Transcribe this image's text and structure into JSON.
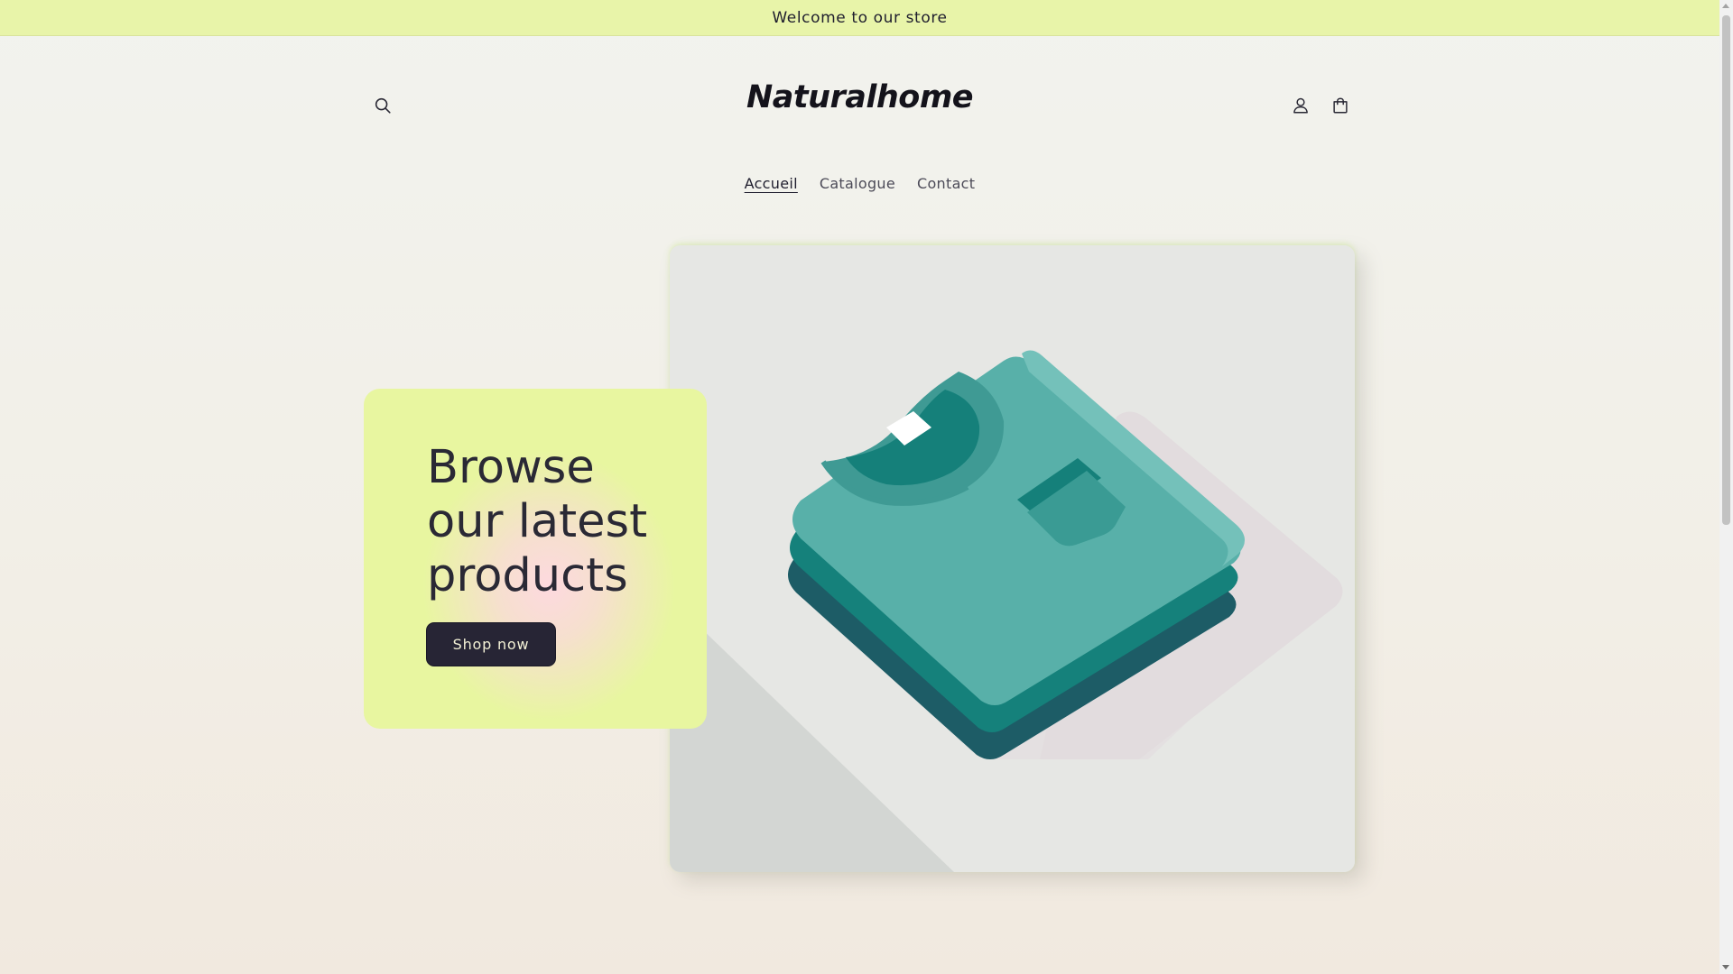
{
  "announcement": {
    "text": "Welcome to our store"
  },
  "header": {
    "logo_text": "Naturalhome",
    "icons": {
      "search": "search-icon",
      "account": "account-icon",
      "cart": "cart-icon"
    }
  },
  "nav": {
    "items": [
      {
        "label": "Accueil",
        "active": true
      },
      {
        "label": "Catalogue",
        "active": false
      },
      {
        "label": "Contact",
        "active": false
      }
    ]
  },
  "hero": {
    "heading": "Browse\nour latest\nproducts",
    "button_label": "Shop now",
    "image": "stack-of-folded-t-shirts-illustration"
  },
  "colors": {
    "announcement_bg": "#e8f4a9",
    "card_bg": "#e8f6a0",
    "button_bg": "#272535",
    "shirt_teal": "#58b0a9"
  }
}
